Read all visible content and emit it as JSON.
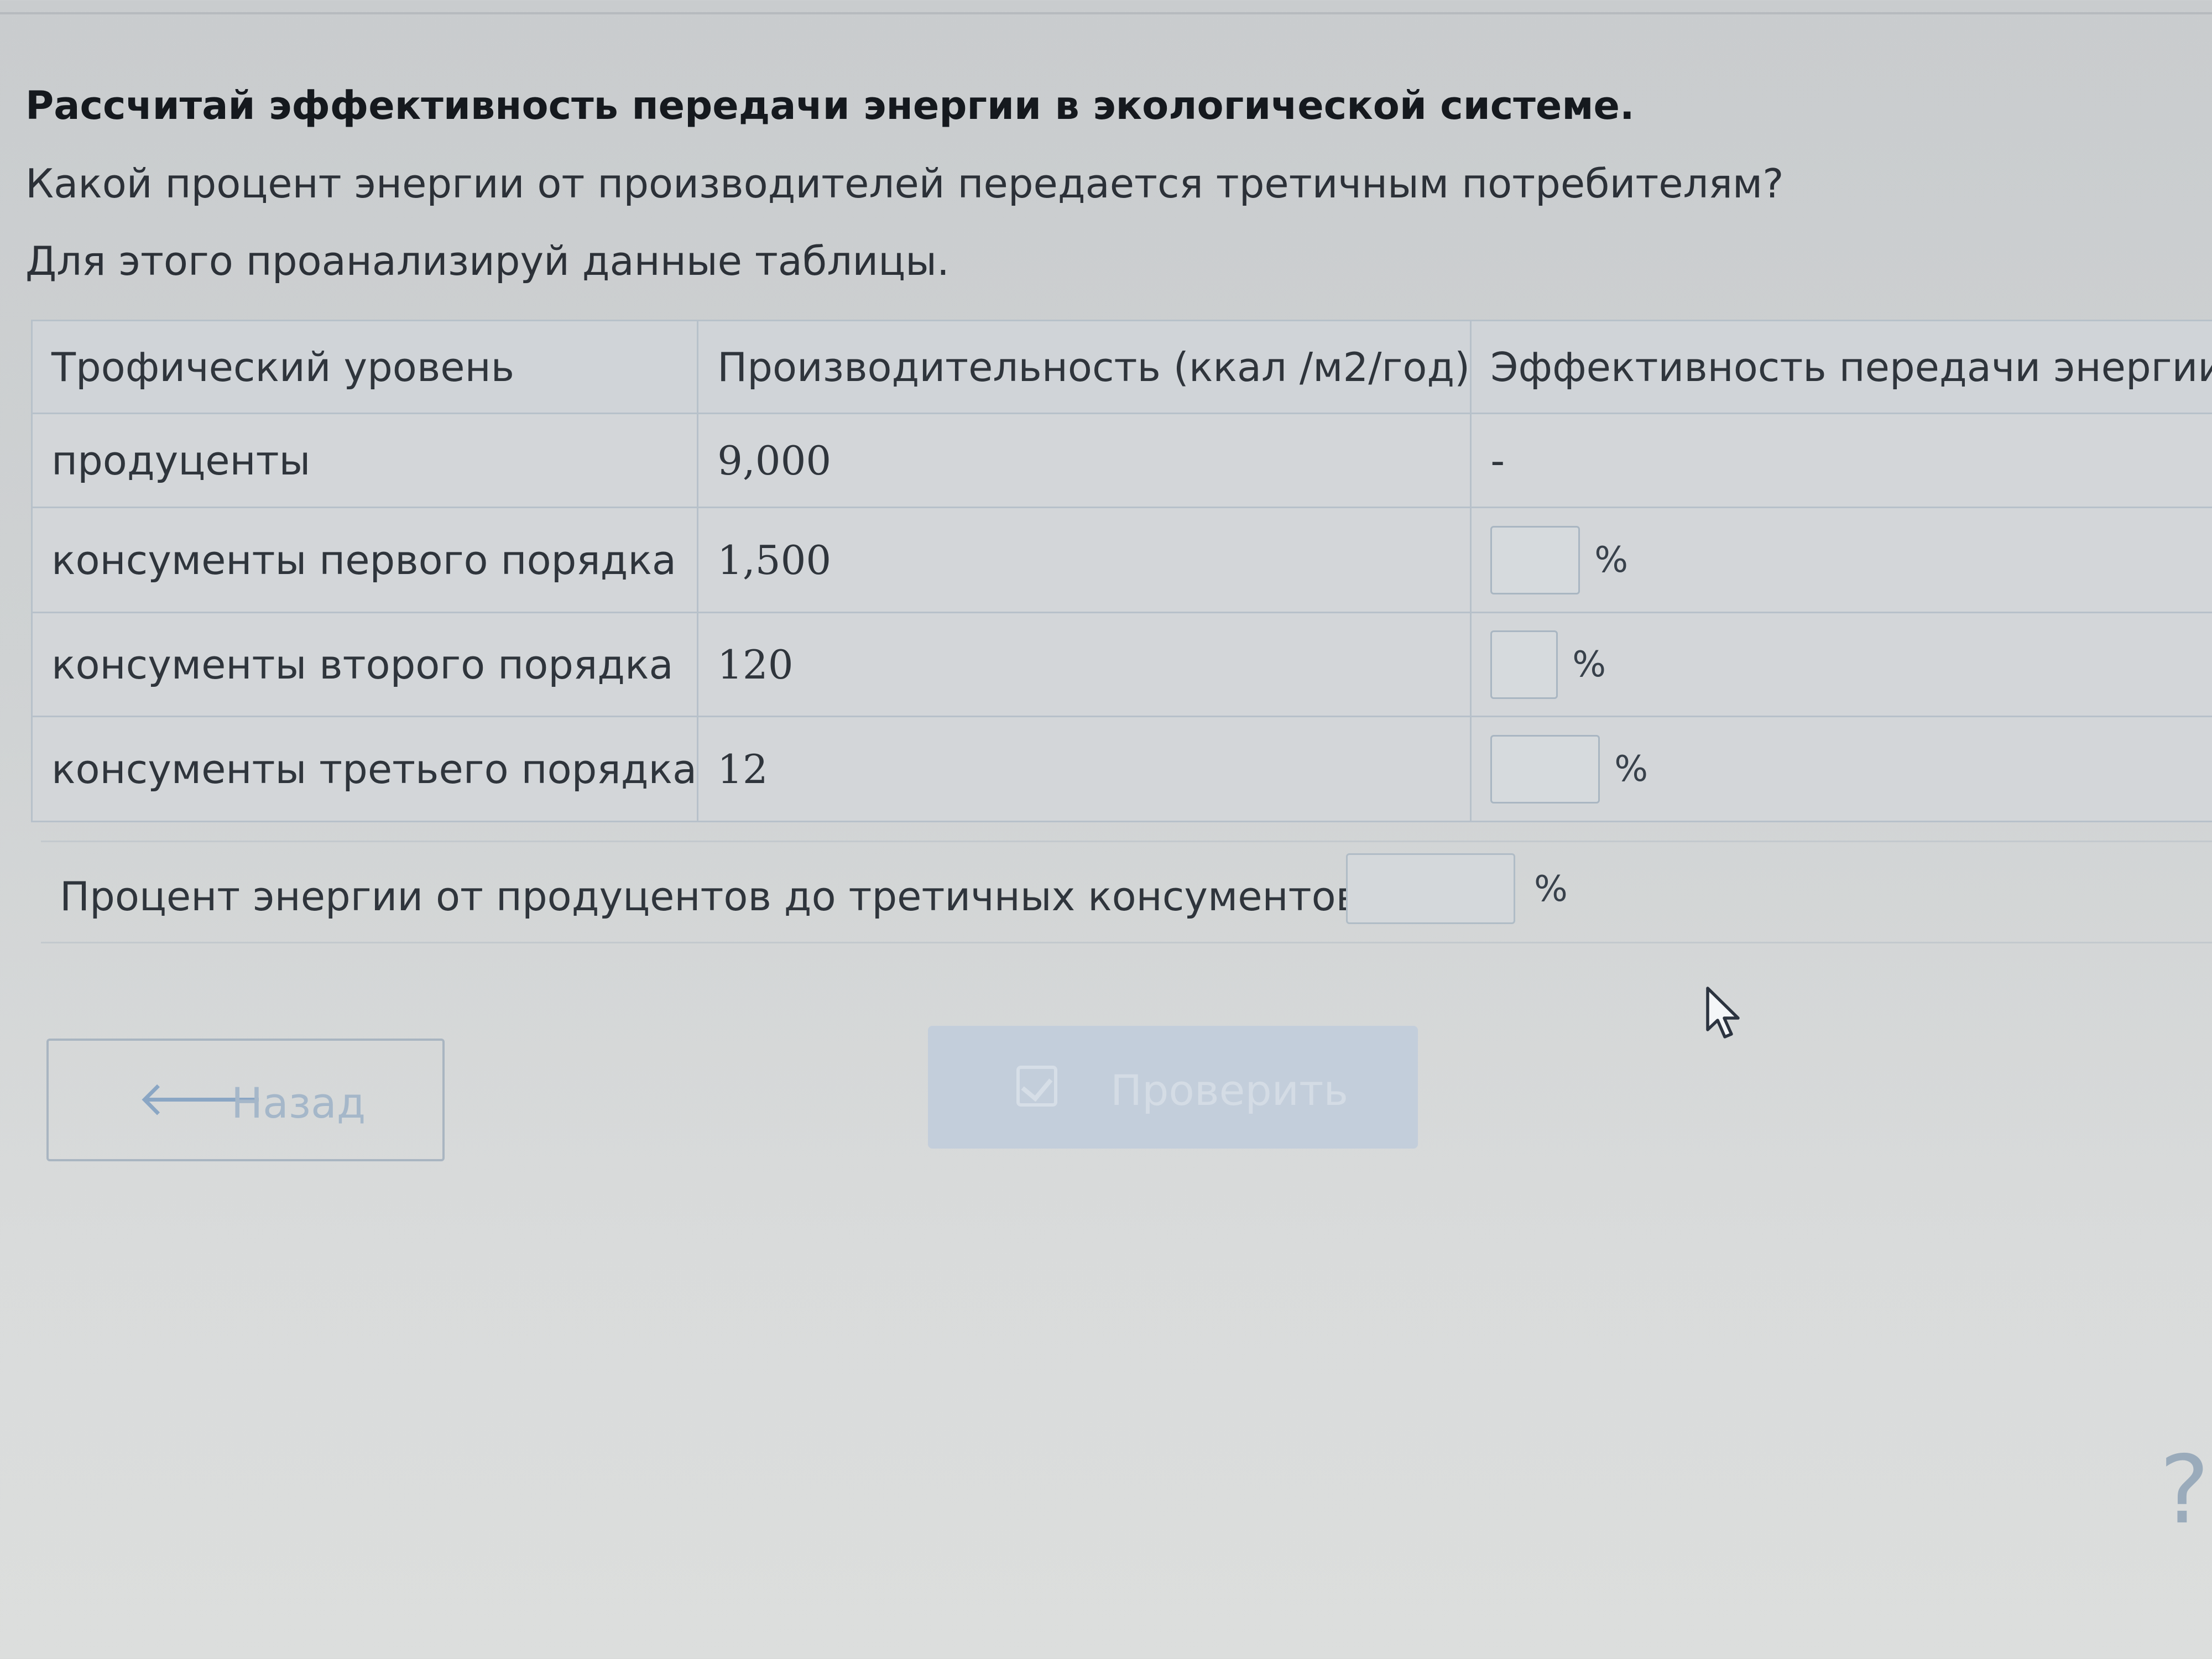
{
  "task": {
    "title": "Рассчитай эффективность передачи энергии в экологической системе.",
    "question": "Какой процент энергии от производителей передается третичным потребителям?",
    "instruction": "Для этого проанализируй данные таблицы."
  },
  "table": {
    "headers": [
      "Трофический уровень",
      "Производительность (ккал /м2/год)",
      "Эффективность передачи энергии"
    ],
    "rows": [
      {
        "level": "продуценты",
        "productivity": "9,000",
        "efficiency": "-"
      },
      {
        "level": "консументы первого порядка",
        "productivity": "1,500",
        "efficiency_input": "",
        "unit": "%"
      },
      {
        "level": "консументы второго порядка",
        "productivity": "120",
        "efficiency_input": "",
        "unit": "%"
      },
      {
        "level": "консументы третьего порядка",
        "productivity": "12",
        "efficiency_input": "",
        "unit": "%"
      }
    ]
  },
  "summary": {
    "label": "Процент энергии от продуцентов до третичных консументов:",
    "value": "",
    "unit": "%"
  },
  "buttons": {
    "back_label": "Назад",
    "check_label": "Проверить"
  },
  "icons": {
    "back": "arrow-left-icon",
    "check": "checkbox-icon",
    "help": "help-icon",
    "cursor": "mouse-cursor-icon"
  },
  "colors": {
    "accent": "#8aa6c4",
    "table_border": "#b7c1ca",
    "check_button_disabled": "#c3cedb"
  }
}
